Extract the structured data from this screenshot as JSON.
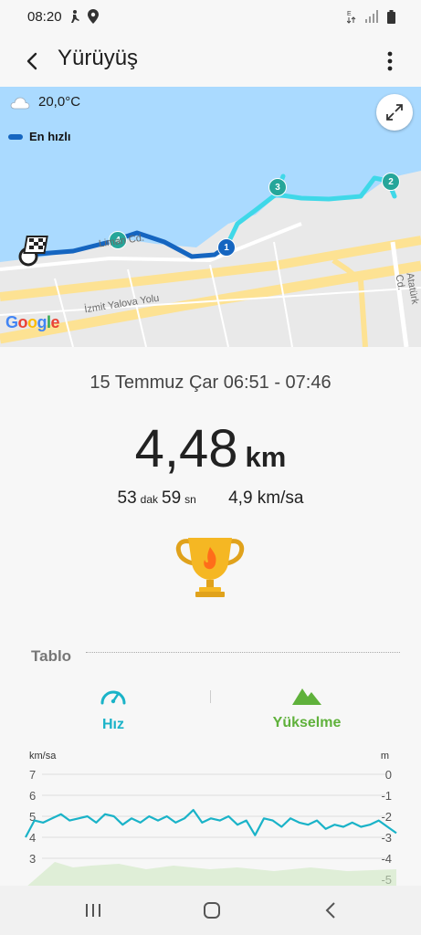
{
  "status": {
    "time": "08:20"
  },
  "header": {
    "title": "Yürüyüş"
  },
  "map": {
    "temperature": "20,0°C",
    "legend_label": "En hızlı",
    "google_label": "Google",
    "roads": {
      "limani": "Liman Cd.",
      "izmit": "İzmit Yalova Yolu",
      "ataturk": "Atatürk Cd."
    },
    "markers": [
      "1",
      "2",
      "3",
      "4"
    ]
  },
  "summary": {
    "date_range": "15 Temmuz Çar 06:51 - 07:46",
    "distance_value": "4,48",
    "distance_unit": "km",
    "minutes": "53",
    "minutes_unit": "dak",
    "seconds": "59",
    "seconds_unit": "sn",
    "avg_speed": "4,9 km/sa"
  },
  "chart_section": {
    "title": "Tablo",
    "tabs": [
      {
        "label": "Hız",
        "color": "#1ab3c8"
      },
      {
        "label": "Yükselme",
        "color": "#5fb13b"
      }
    ]
  },
  "chart_data": {
    "type": "line",
    "y_left_unit": "km/sa",
    "y_right_unit": "m",
    "y_left_ticks": [
      "7",
      "6",
      "5",
      "4",
      "3"
    ],
    "y_right_ticks": [
      "0",
      "-1",
      "-2",
      "-3",
      "-4",
      "-5"
    ],
    "ylim_left": [
      3,
      7
    ],
    "series": [
      {
        "values": [
          4.0,
          4.8,
          4.7,
          4.9,
          5.1,
          4.8,
          4.9,
          5.0,
          4.7,
          5.1,
          5.0,
          4.6,
          4.9,
          4.7,
          5.0,
          4.8,
          5.0,
          4.7,
          4.9,
          5.3,
          4.7,
          4.9,
          4.8,
          5.0,
          4.6,
          4.8,
          4.1,
          4.9,
          4.8,
          4.5,
          4.9,
          4.7,
          4.6,
          4.8,
          4.4,
          4.6,
          4.5,
          4.7,
          4.5,
          4.6,
          4.8,
          4.5,
          4.2
        ]
      }
    ]
  },
  "colors": {
    "accent": "#1ab3c8",
    "elevation": "#5fb13b",
    "route_fast": "#1565c0",
    "route": "#3fd8e8"
  },
  "icons": {
    "back": "arrow-left-icon",
    "more": "more-vert-icon",
    "expand": "expand-icon",
    "trophy": "trophy-icon",
    "speed": "speedometer-icon",
    "elevation": "mountain-icon"
  }
}
